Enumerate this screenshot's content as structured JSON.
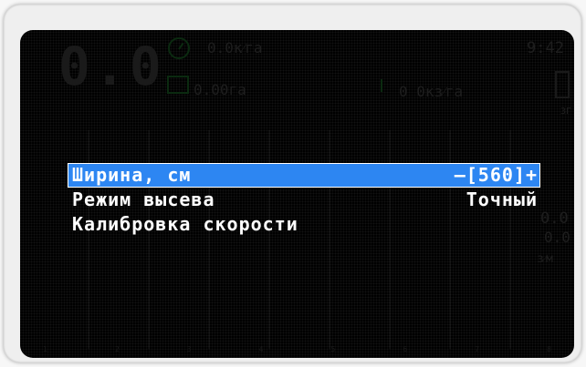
{
  "background_display": {
    "main_value": "0.0",
    "area_rate": "0.0к⁄га",
    "seed_area": "0.00га",
    "plant_rate": "0 0кз⁄га",
    "clock": "9:42",
    "side_value_1": "0.0",
    "side_value_2": "0.0",
    "side_unit": "з⁄м",
    "mini_label": "ЗГ",
    "row_ticks": [
      "1",
      "2",
      "3",
      "4",
      "5",
      "6",
      "7",
      "8"
    ]
  },
  "menu": {
    "items": [
      {
        "label": "Ширина, см",
        "value": "–[560]+",
        "selected": true
      },
      {
        "label": "Режим высева",
        "value": "Точный",
        "selected": false
      },
      {
        "label": "Калибровка скорости",
        "value": "",
        "selected": false
      }
    ]
  },
  "colors": {
    "highlight": "#2d86f2",
    "screen": "#000000",
    "bezel": "#efefef"
  }
}
